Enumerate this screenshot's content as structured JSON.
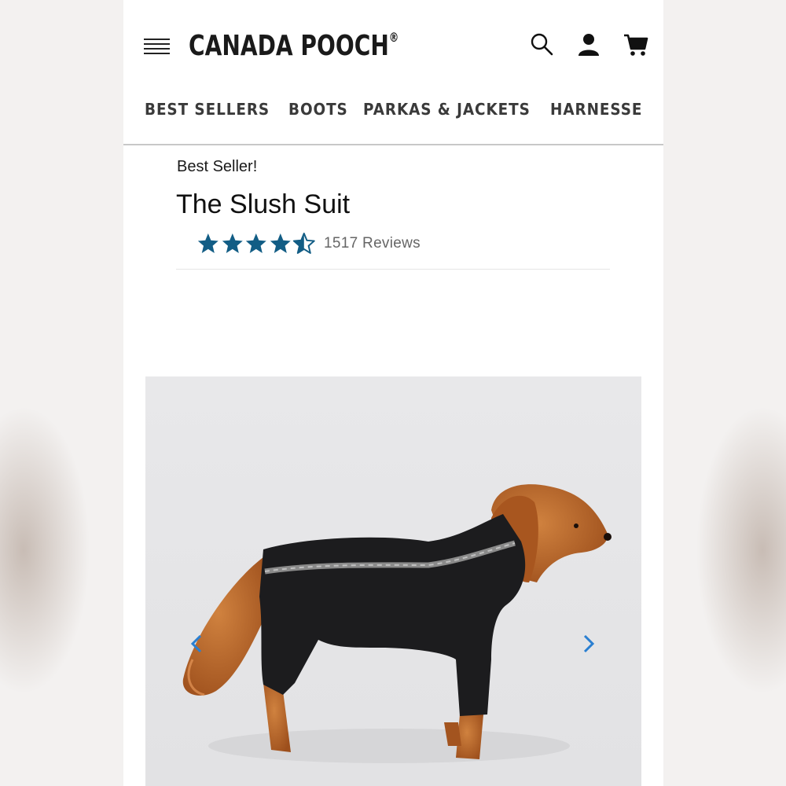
{
  "header": {
    "brand": "CANADA POOCH",
    "brand_mark": "®"
  },
  "nav": {
    "items": [
      {
        "label": "BEST SELLERS"
      },
      {
        "label": "BOOTS"
      },
      {
        "label": "PARKAS & JACKETS"
      },
      {
        "label": "HARNESSE"
      }
    ]
  },
  "product": {
    "badge": "Best Seller!",
    "title": "The Slush Suit",
    "rating": 4.5,
    "rating_max": 5,
    "reviews_label": "1517 Reviews"
  },
  "colors": {
    "star": "#125d85",
    "text": "#1a1a1a",
    "arrow": "#2a7fd1"
  },
  "icons": [
    "menu-icon",
    "search-icon",
    "account-icon",
    "cart-icon",
    "star-icon",
    "chevron-left-icon",
    "chevron-right-icon"
  ]
}
